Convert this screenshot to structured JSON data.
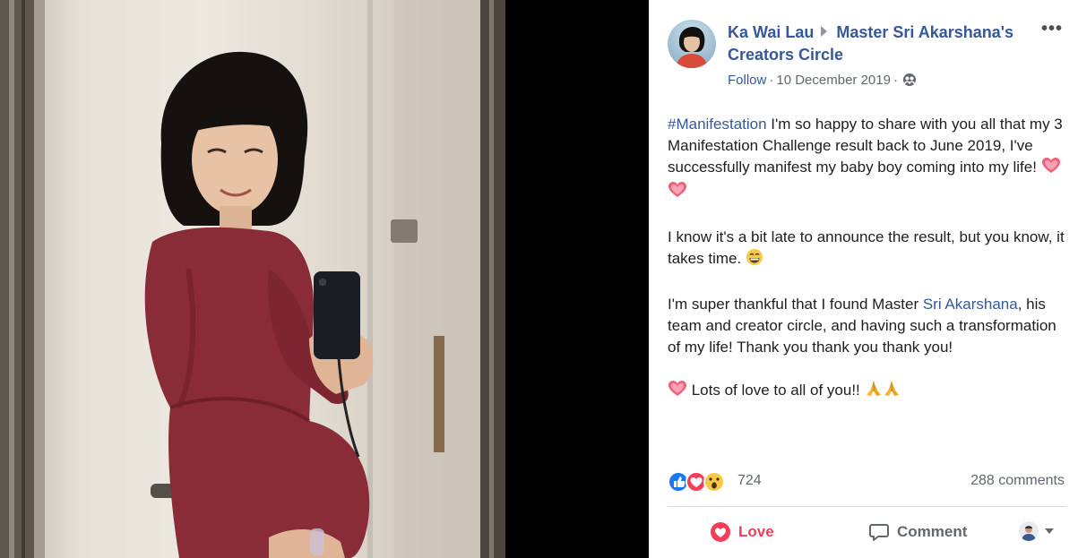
{
  "post": {
    "author": "Ka Wai Lau",
    "group": "Master Sri Akarshana's Creators Circle",
    "follow": "Follow",
    "date": "10 December 2019",
    "more": "•••",
    "text": {
      "hashtag": "#Manifestation",
      "p1_rest": " I'm so happy to share with you all that my 3 Manifestation Challenge result back to June 2019, I've successfully manifest my baby boy coming into my life! ",
      "p2": "I know it's a bit late to announce the result, but you know, it takes time. ",
      "p3_before": "I'm super thankful that I found Master ",
      "p3_link": "Sri Akarshana",
      "p3_after": ", his team and creator circle, and having such a transformation of my life! Thank you thank you thank you!",
      "p4": " Lots of love to all of you!! "
    },
    "reactions": {
      "types": [
        "like-icon",
        "love-icon",
        "wow-icon"
      ],
      "count": "724"
    },
    "comments": "288 comments",
    "actions": {
      "love": "Love",
      "comment": "Comment"
    }
  },
  "colors": {
    "link": "#365899",
    "love": "#f33e58",
    "secondary_text": "#606770",
    "photo_dress": "#8a2c38"
  },
  "icons": {
    "audience": "friends-icon",
    "emoji_heart": "sparkling-heart-icon",
    "emoji_grin": "grinning-face-icon",
    "emoji_pray": "folded-hands-icon"
  }
}
